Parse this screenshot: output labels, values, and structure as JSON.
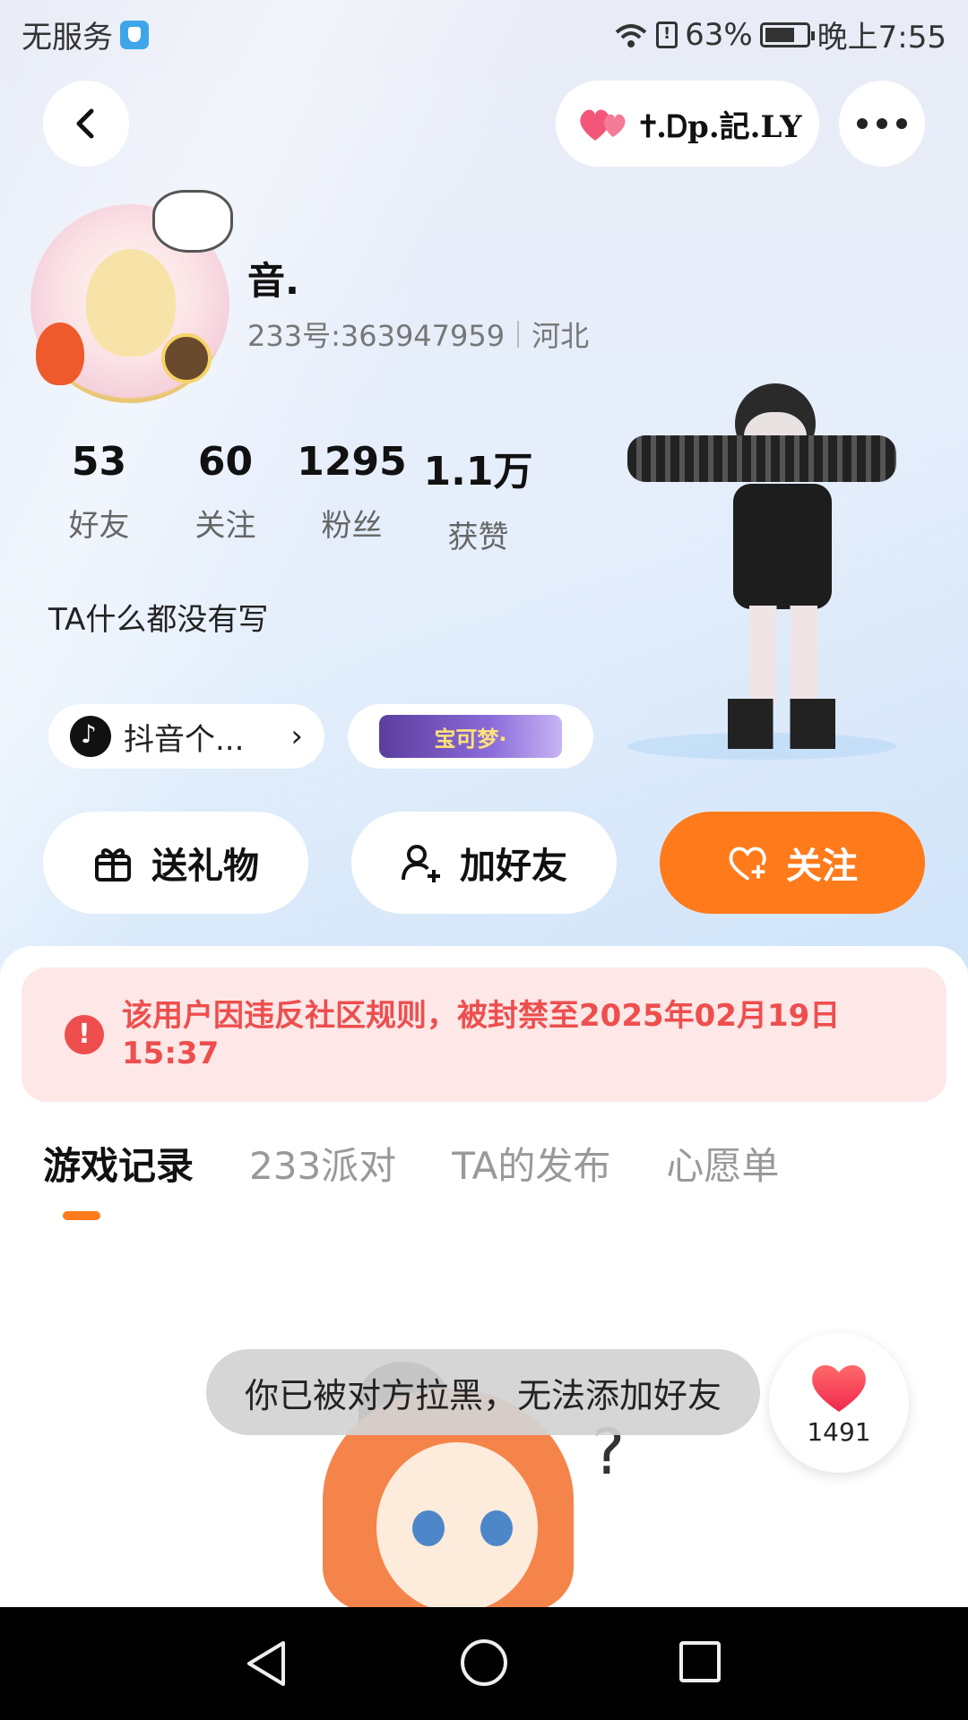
{
  "status_bar": {
    "carrier": "无服务",
    "battery": "63%",
    "time": "晚上7:55"
  },
  "header": {
    "nickname_badge": "✝.Ꭰp.記.LY"
  },
  "profile": {
    "name": "音.",
    "id_label": "233号:363947959",
    "location": "河北",
    "bio": "TA什么都没有写"
  },
  "stats": [
    {
      "value": "53",
      "label": "好友"
    },
    {
      "value": "60",
      "label": "关注"
    },
    {
      "value": "1295",
      "label": "粉丝"
    },
    {
      "value": "1.1万",
      "label": "获赞"
    }
  ],
  "links": {
    "douyin": "抖音个...",
    "pokemon_banner": "宝可梦·"
  },
  "actions": {
    "gift": "送礼物",
    "add_friend": "加好友",
    "follow": "关注"
  },
  "ban_notice": "该用户因违反社区规则，被封禁至2025年02月19日15:37",
  "tabs": [
    {
      "label": "游戏记录",
      "active": true
    },
    {
      "label": "233派对",
      "active": false
    },
    {
      "label": "TA的发布",
      "active": false
    },
    {
      "label": "心愿单",
      "active": false
    }
  ],
  "toast": "你已被对方拉黑，无法添加好友",
  "like_float": {
    "count": "1491"
  },
  "colors": {
    "accent": "#ff7a1a",
    "ban_text": "#ee4e4e",
    "ban_bg": "#fde7e7"
  },
  "icons": [
    "back-icon",
    "heart-icon",
    "more-icon",
    "gift-icon",
    "add-user-icon",
    "heart-plus-icon",
    "alert-icon",
    "douyin-icon",
    "chevron-right-icon"
  ]
}
